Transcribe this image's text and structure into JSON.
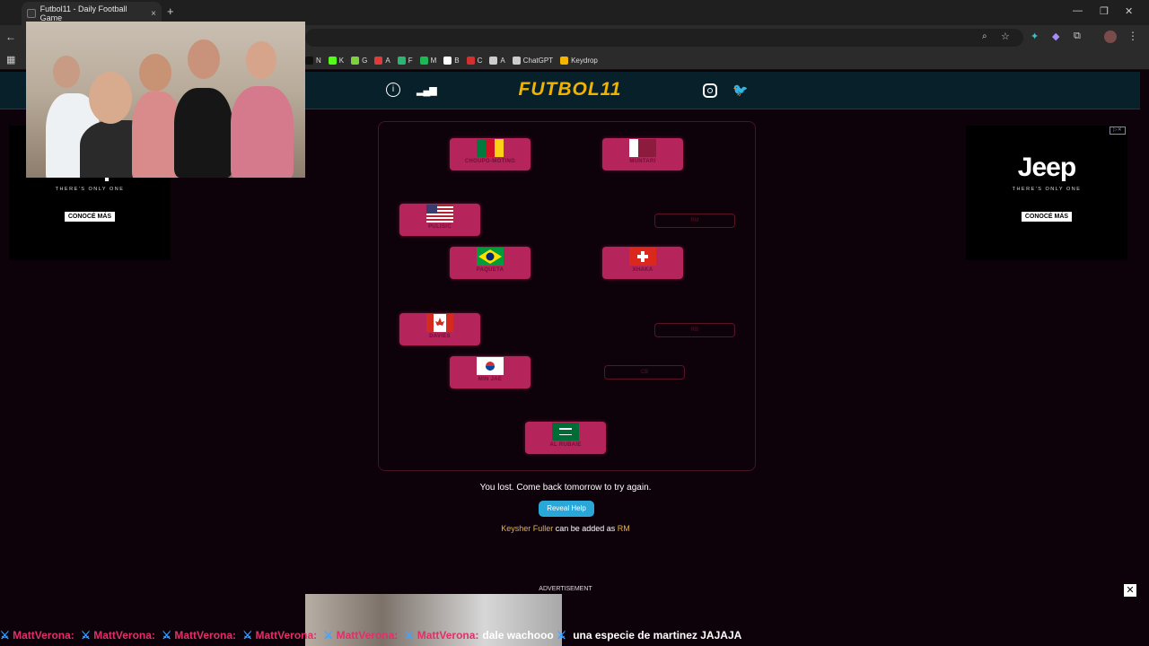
{
  "browser": {
    "tab_title": "Futbol11 - Daily Football Game",
    "tab_close": "×",
    "new_tab": "+",
    "bookmarks": [
      {
        "label": "N",
        "color": "#111"
      },
      {
        "label": "K",
        "color": "#53fc18"
      },
      {
        "label": "G",
        "color": "#7bd23a"
      },
      {
        "label": "A",
        "color": "#e03a3a"
      },
      {
        "label": "F",
        "color": "#2bb673"
      },
      {
        "label": "M",
        "color": "#1db954"
      },
      {
        "label": "B",
        "color": "#ffffff"
      },
      {
        "label": "C",
        "color": "#d32f2f"
      },
      {
        "label": "A",
        "color": "#cccccc"
      },
      {
        "label": "ChatGPT",
        "color": "#cccccc"
      },
      {
        "label": "Keydrop",
        "color": "#f4b400"
      }
    ]
  },
  "header": {
    "logo": "FUTBOL11",
    "info_icon": "ⓘ",
    "stats_icon": "▂▄▆",
    "instagram_icon": "◎",
    "twitter_icon": "🐦"
  },
  "ads": {
    "left": {
      "brand": "Jeep",
      "tagline": "THERE'S ONLY ONE",
      "cta": "CONOCÉ MÁS"
    },
    "right": {
      "brand": "Jeep",
      "tagline": "THERE'S ONLY ONE",
      "cta": "CONOCÉ MÁS"
    },
    "bottom_label": "ADVERTISEMENT",
    "close": "✕"
  },
  "pitch": {
    "players": [
      {
        "name": "CHOUPO-MOTING",
        "flag": "cameroon"
      },
      {
        "name": "MUNTARI",
        "flag": "qatar"
      },
      {
        "name": "PULISIC",
        "flag": "usa"
      },
      {
        "name": "PAQUETA",
        "flag": "brazil"
      },
      {
        "name": "XHAKA",
        "flag": "switzerland"
      },
      {
        "name": "DAVIES",
        "flag": "canada"
      },
      {
        "name": "MIN JAE",
        "flag": "korea"
      },
      {
        "name": "AL RUBAIE",
        "flag": "saudi"
      }
    ],
    "empty_slots": [
      "RM",
      "RB",
      "CB"
    ]
  },
  "result": {
    "lost_message": "You lost. Come back tomorrow to try again.",
    "reveal_button": "Reveal Help",
    "hint_player": "Keysher Fuller",
    "hint_middle": " can be added as ",
    "hint_position": "RM"
  },
  "chat": {
    "entries": [
      {
        "user": "MattVerona:",
        "msg": ""
      },
      {
        "user": "MattVerona:",
        "msg": ""
      },
      {
        "user": "MattVerona:",
        "msg": ""
      },
      {
        "user": "MattVerona:",
        "msg": ""
      },
      {
        "user": "MattVerona:",
        "msg": ""
      },
      {
        "user": "MattVerona:",
        "msg": "dale wachooo"
      },
      {
        "user": "",
        "msg": "una especie de martinez JAJAJA"
      }
    ]
  }
}
